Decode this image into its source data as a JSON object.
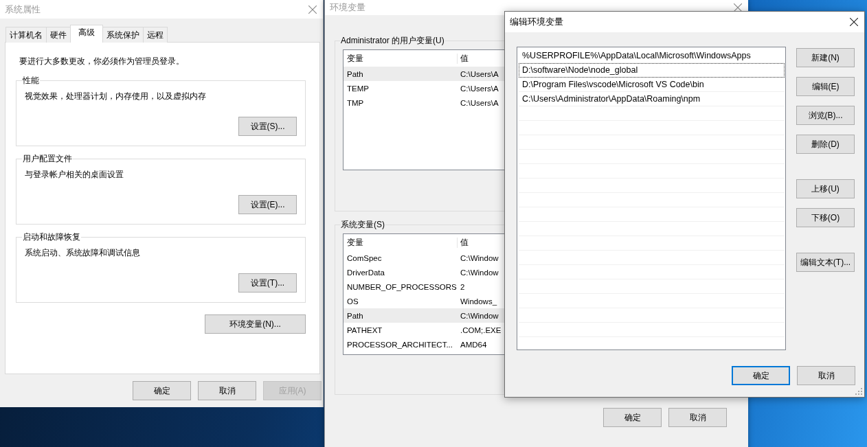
{
  "system_properties": {
    "title": "系统属性",
    "tabs": [
      {
        "label": "计算机名",
        "selected": false
      },
      {
        "label": "硬件",
        "selected": false
      },
      {
        "label": "高级",
        "selected": true
      },
      {
        "label": "系统保护",
        "selected": false
      },
      {
        "label": "远程",
        "selected": false
      }
    ],
    "notice": "要进行大多数更改，你必须作为管理员登录。",
    "groups": [
      {
        "title": "性能",
        "description": "视觉效果，处理器计划，内存使用，以及虚拟内存",
        "button": "设置(S)..."
      },
      {
        "title": "用户配置文件",
        "description": "与登录帐户相关的桌面设置",
        "button": "设置(E)..."
      },
      {
        "title": "启动和故障恢复",
        "description": "系统启动、系统故障和调试信息",
        "button": "设置(T)..."
      }
    ],
    "env_button": "环境变量(N)...",
    "buttons": [
      {
        "label": "确定",
        "disabled": false
      },
      {
        "label": "取消",
        "disabled": false
      },
      {
        "label": "应用(A)",
        "disabled": true
      }
    ]
  },
  "environment_variables": {
    "title": "环境变量",
    "user_vars": {
      "title": "Administrator 的用户变量(U)",
      "columns": [
        "变量",
        "值"
      ],
      "rows": [
        {
          "name": "Path",
          "value": "C:\\Users\\A",
          "selected": true
        },
        {
          "name": "TEMP",
          "value": "C:\\Users\\A",
          "selected": false
        },
        {
          "name": "TMP",
          "value": "C:\\Users\\A",
          "selected": false
        }
      ]
    },
    "system_vars": {
      "title": "系统变量(S)",
      "columns": [
        "变量",
        "值"
      ],
      "rows": [
        {
          "name": "ComSpec",
          "value": "C:\\Window",
          "selected": false
        },
        {
          "name": "DriverData",
          "value": "C:\\Window",
          "selected": false
        },
        {
          "name": "NUMBER_OF_PROCESSORS",
          "value": "2",
          "selected": false
        },
        {
          "name": "OS",
          "value": "Windows_",
          "selected": false
        },
        {
          "name": "Path",
          "value": "C:\\Window",
          "selected": true
        },
        {
          "name": "PATHEXT",
          "value": ".COM;.EXE",
          "selected": false
        },
        {
          "name": "PROCESSOR_ARCHITECT...",
          "value": "AMD64",
          "selected": false
        }
      ]
    },
    "buttons": [
      "确定",
      "取消"
    ]
  },
  "edit_environment_variable": {
    "title": "编辑环境变量",
    "entries": [
      {
        "text": "%USERPROFILE%\\AppData\\Local\\Microsoft\\WindowsApps",
        "focused": false
      },
      {
        "text": "D:\\software\\Node\\node_global",
        "focused": true
      },
      {
        "text": "D:\\Program Files\\vscode\\Microsoft VS Code\\bin",
        "focused": false
      },
      {
        "text": "C:\\Users\\Administrator\\AppData\\Roaming\\npm",
        "focused": false
      }
    ],
    "side_button_groups": [
      {
        "buttons": [
          "新建(N)",
          "编辑(E)",
          "浏览(B)...",
          "删除(D)"
        ]
      },
      {
        "buttons": [
          "上移(U)",
          "下移(O)"
        ]
      },
      {
        "buttons": [
          "编辑文本(T)..."
        ]
      }
    ],
    "buttons": [
      {
        "label": "确定",
        "default": true
      },
      {
        "label": "取消",
        "default": false
      }
    ]
  }
}
